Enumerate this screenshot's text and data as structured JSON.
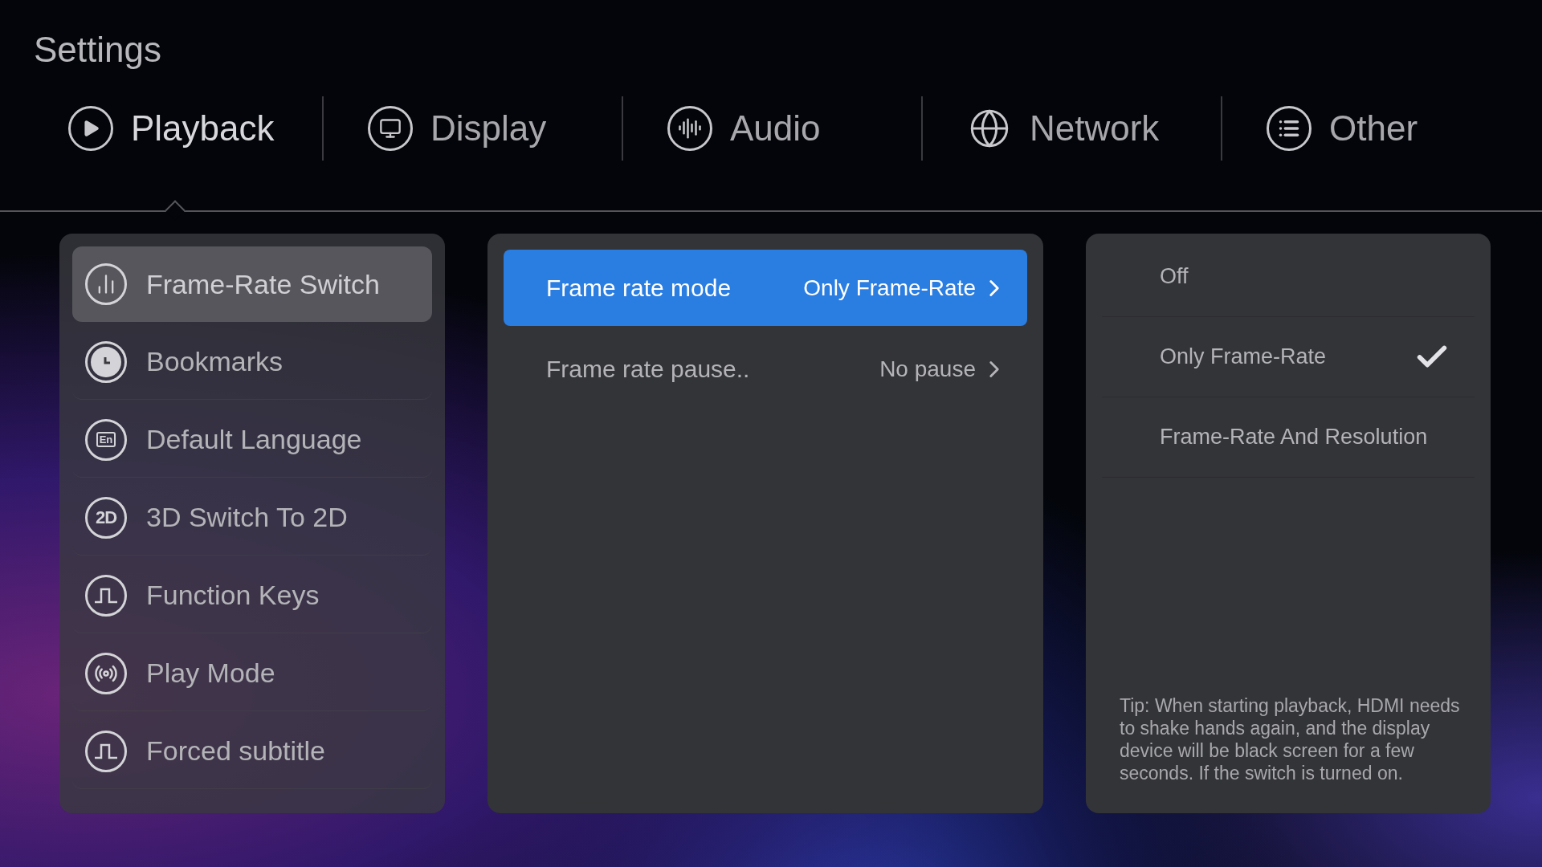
{
  "title": "Settings",
  "tabs": [
    {
      "label": "Playback",
      "kind": "play",
      "selected": true
    },
    {
      "label": "Display",
      "kind": "monitor",
      "selected": false
    },
    {
      "label": "Audio",
      "kind": "audio",
      "selected": false
    },
    {
      "label": "Network",
      "kind": "globe",
      "selected": false
    },
    {
      "label": "Other",
      "kind": "list",
      "selected": false
    }
  ],
  "menu": [
    {
      "label": "Frame-Rate Switch",
      "kind": "bars",
      "selected": true
    },
    {
      "label": "Bookmarks",
      "kind": "clock",
      "selected": false
    },
    {
      "label": "Default Language",
      "kind": "language",
      "icon_text": "En",
      "selected": false
    },
    {
      "label": "3D Switch To 2D",
      "kind": "badge",
      "icon_text": "2D",
      "selected": false
    },
    {
      "label": "Function Keys",
      "kind": "pulse",
      "selected": false
    },
    {
      "label": "Play Mode",
      "kind": "broadcast",
      "selected": false
    },
    {
      "label": "Forced subtitle",
      "kind": "pulse",
      "selected": false
    }
  ],
  "options": [
    {
      "label": "Frame rate mode",
      "value": "Only Frame-Rate",
      "selected": true
    },
    {
      "label": "Frame rate pause..",
      "value": "No pause",
      "selected": false
    }
  ],
  "choices": [
    {
      "label": "Off",
      "checked": false
    },
    {
      "label": "Only Frame-Rate",
      "checked": true
    },
    {
      "label": "Frame-Rate And Resolution",
      "checked": false
    }
  ],
  "tip": "Tip: When starting playback, HDMI needs to shake hands again, and the display device will be black screen for a few seconds. If the switch is turned on."
}
